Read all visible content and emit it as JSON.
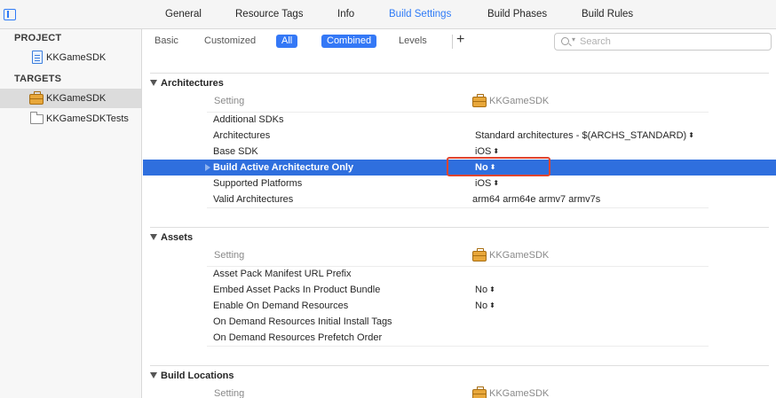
{
  "top_tabs": [
    "General",
    "Resource Tags",
    "Info",
    "Build Settings",
    "Build Phases",
    "Build Rules"
  ],
  "active_top_tab": "Build Settings",
  "sidebar": {
    "project_header": "PROJECT",
    "project_item": "KKGameSDK",
    "targets_header": "TARGETS",
    "targets": [
      "KKGameSDK",
      "KKGameSDKTests"
    ],
    "selected_target": "KKGameSDK"
  },
  "filter": {
    "basic": "Basic",
    "customized": "Customized",
    "all": "All",
    "combined": "Combined",
    "levels": "Levels",
    "add": "+",
    "search_placeholder": "Search"
  },
  "sections": [
    {
      "title": "Architectures",
      "setting_col": "Setting",
      "target_col": "KKGameSDK",
      "rows": [
        {
          "name": "Additional SDKs",
          "value": ""
        },
        {
          "name": "Architectures",
          "value": "Standard architectures  -  $(ARCHS_STANDARD)",
          "stepper": true
        },
        {
          "name": "Base SDK",
          "value": "iOS",
          "stepper": true
        },
        {
          "name": "Build Active Architecture Only",
          "value": "No",
          "stepper": true,
          "selected": true
        },
        {
          "name": "Supported Platforms",
          "value": "iOS",
          "stepper": true
        },
        {
          "name": "Valid Architectures",
          "value": "arm64 arm64e armv7 armv7s"
        }
      ]
    },
    {
      "title": "Assets",
      "setting_col": "Setting",
      "target_col": "KKGameSDK",
      "rows": [
        {
          "name": "Asset Pack Manifest URL Prefix",
          "value": ""
        },
        {
          "name": "Embed Asset Packs In Product Bundle",
          "value": "No",
          "stepper": true
        },
        {
          "name": "Enable On Demand Resources",
          "value": "No",
          "stepper": true
        },
        {
          "name": "On Demand Resources Initial Install Tags",
          "value": ""
        },
        {
          "name": "On Demand Resources Prefetch Order",
          "value": ""
        }
      ]
    },
    {
      "title": "Build Locations",
      "setting_col": "Setting",
      "target_col": "KKGameSDK",
      "rows": []
    }
  ],
  "colors": {
    "accent": "#2f7bf6",
    "selection": "#2f6fde",
    "highlight_box": "#e0452f"
  },
  "icons": [
    "sidebar-toggle-icon",
    "document-icon",
    "briefcase-icon",
    "folder-icon",
    "search-icon"
  ]
}
